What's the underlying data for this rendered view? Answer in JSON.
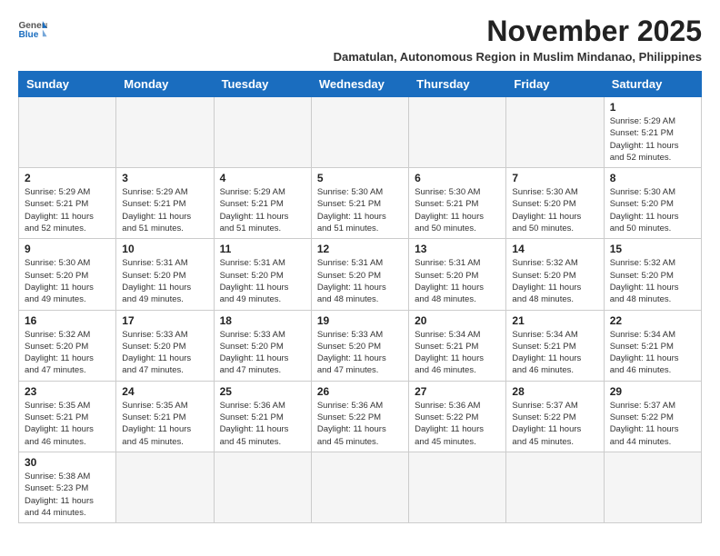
{
  "header": {
    "logo_general": "General",
    "logo_blue": "Blue",
    "month_title": "November 2025",
    "subtitle": "Damatulan, Autonomous Region in Muslim Mindanao, Philippines"
  },
  "days_of_week": [
    "Sunday",
    "Monday",
    "Tuesday",
    "Wednesday",
    "Thursday",
    "Friday",
    "Saturday"
  ],
  "weeks": [
    [
      {
        "day": "",
        "info": ""
      },
      {
        "day": "",
        "info": ""
      },
      {
        "day": "",
        "info": ""
      },
      {
        "day": "",
        "info": ""
      },
      {
        "day": "",
        "info": ""
      },
      {
        "day": "",
        "info": ""
      },
      {
        "day": "1",
        "info": "Sunrise: 5:29 AM\nSunset: 5:21 PM\nDaylight: 11 hours\nand 52 minutes."
      }
    ],
    [
      {
        "day": "2",
        "info": "Sunrise: 5:29 AM\nSunset: 5:21 PM\nDaylight: 11 hours\nand 52 minutes."
      },
      {
        "day": "3",
        "info": "Sunrise: 5:29 AM\nSunset: 5:21 PM\nDaylight: 11 hours\nand 51 minutes."
      },
      {
        "day": "4",
        "info": "Sunrise: 5:29 AM\nSunset: 5:21 PM\nDaylight: 11 hours\nand 51 minutes."
      },
      {
        "day": "5",
        "info": "Sunrise: 5:30 AM\nSunset: 5:21 PM\nDaylight: 11 hours\nand 51 minutes."
      },
      {
        "day": "6",
        "info": "Sunrise: 5:30 AM\nSunset: 5:21 PM\nDaylight: 11 hours\nand 50 minutes."
      },
      {
        "day": "7",
        "info": "Sunrise: 5:30 AM\nSunset: 5:20 PM\nDaylight: 11 hours\nand 50 minutes."
      },
      {
        "day": "8",
        "info": "Sunrise: 5:30 AM\nSunset: 5:20 PM\nDaylight: 11 hours\nand 50 minutes."
      }
    ],
    [
      {
        "day": "9",
        "info": "Sunrise: 5:30 AM\nSunset: 5:20 PM\nDaylight: 11 hours\nand 49 minutes."
      },
      {
        "day": "10",
        "info": "Sunrise: 5:31 AM\nSunset: 5:20 PM\nDaylight: 11 hours\nand 49 minutes."
      },
      {
        "day": "11",
        "info": "Sunrise: 5:31 AM\nSunset: 5:20 PM\nDaylight: 11 hours\nand 49 minutes."
      },
      {
        "day": "12",
        "info": "Sunrise: 5:31 AM\nSunset: 5:20 PM\nDaylight: 11 hours\nand 48 minutes."
      },
      {
        "day": "13",
        "info": "Sunrise: 5:31 AM\nSunset: 5:20 PM\nDaylight: 11 hours\nand 48 minutes."
      },
      {
        "day": "14",
        "info": "Sunrise: 5:32 AM\nSunset: 5:20 PM\nDaylight: 11 hours\nand 48 minutes."
      },
      {
        "day": "15",
        "info": "Sunrise: 5:32 AM\nSunset: 5:20 PM\nDaylight: 11 hours\nand 48 minutes."
      }
    ],
    [
      {
        "day": "16",
        "info": "Sunrise: 5:32 AM\nSunset: 5:20 PM\nDaylight: 11 hours\nand 47 minutes."
      },
      {
        "day": "17",
        "info": "Sunrise: 5:33 AM\nSunset: 5:20 PM\nDaylight: 11 hours\nand 47 minutes."
      },
      {
        "day": "18",
        "info": "Sunrise: 5:33 AM\nSunset: 5:20 PM\nDaylight: 11 hours\nand 47 minutes."
      },
      {
        "day": "19",
        "info": "Sunrise: 5:33 AM\nSunset: 5:20 PM\nDaylight: 11 hours\nand 47 minutes."
      },
      {
        "day": "20",
        "info": "Sunrise: 5:34 AM\nSunset: 5:21 PM\nDaylight: 11 hours\nand 46 minutes."
      },
      {
        "day": "21",
        "info": "Sunrise: 5:34 AM\nSunset: 5:21 PM\nDaylight: 11 hours\nand 46 minutes."
      },
      {
        "day": "22",
        "info": "Sunrise: 5:34 AM\nSunset: 5:21 PM\nDaylight: 11 hours\nand 46 minutes."
      }
    ],
    [
      {
        "day": "23",
        "info": "Sunrise: 5:35 AM\nSunset: 5:21 PM\nDaylight: 11 hours\nand 46 minutes."
      },
      {
        "day": "24",
        "info": "Sunrise: 5:35 AM\nSunset: 5:21 PM\nDaylight: 11 hours\nand 45 minutes."
      },
      {
        "day": "25",
        "info": "Sunrise: 5:36 AM\nSunset: 5:21 PM\nDaylight: 11 hours\nand 45 minutes."
      },
      {
        "day": "26",
        "info": "Sunrise: 5:36 AM\nSunset: 5:22 PM\nDaylight: 11 hours\nand 45 minutes."
      },
      {
        "day": "27",
        "info": "Sunrise: 5:36 AM\nSunset: 5:22 PM\nDaylight: 11 hours\nand 45 minutes."
      },
      {
        "day": "28",
        "info": "Sunrise: 5:37 AM\nSunset: 5:22 PM\nDaylight: 11 hours\nand 45 minutes."
      },
      {
        "day": "29",
        "info": "Sunrise: 5:37 AM\nSunset: 5:22 PM\nDaylight: 11 hours\nand 44 minutes."
      }
    ],
    [
      {
        "day": "30",
        "info": "Sunrise: 5:38 AM\nSunset: 5:23 PM\nDaylight: 11 hours\nand 44 minutes."
      },
      {
        "day": "",
        "info": ""
      },
      {
        "day": "",
        "info": ""
      },
      {
        "day": "",
        "info": ""
      },
      {
        "day": "",
        "info": ""
      },
      {
        "day": "",
        "info": ""
      },
      {
        "day": "",
        "info": ""
      }
    ]
  ]
}
